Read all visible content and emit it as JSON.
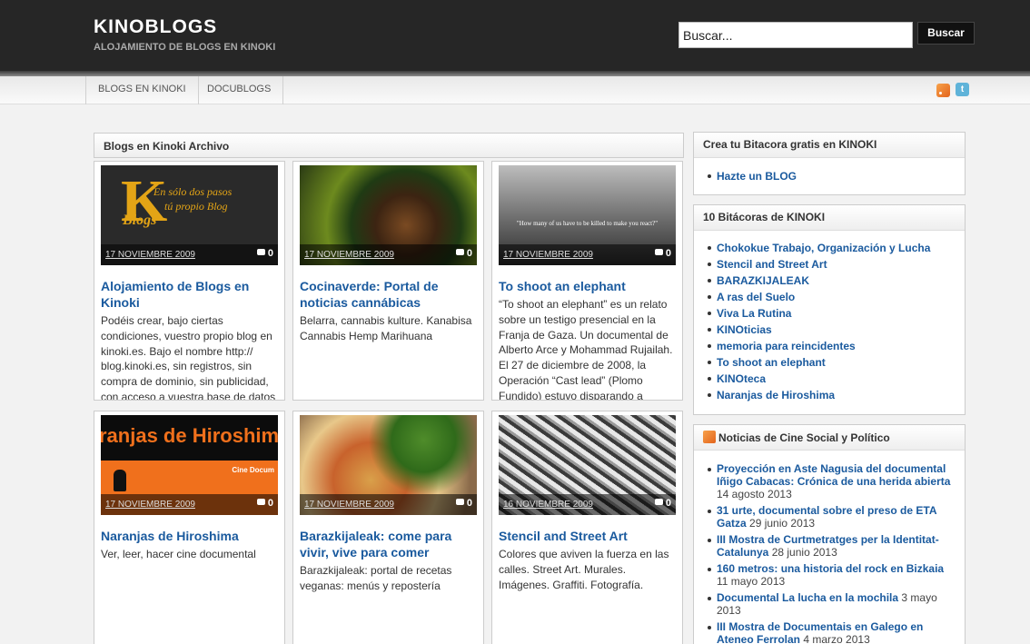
{
  "site": {
    "title": "KINOBLOGS",
    "description": "ALOJAMIENTO DE BLOGS EN KINOKI"
  },
  "search": {
    "value": "Buscar...",
    "button": "Buscar"
  },
  "nav": {
    "items": [
      "BLOGS EN KINOKI",
      "DOCUBLOGS"
    ],
    "icons": [
      "rss-icon",
      "twitter-icon"
    ]
  },
  "main": {
    "heading": "Blogs en Kinoki Archivo",
    "posts": [
      {
        "title": "Alojamiento de Blogs en Kinoki",
        "date": "17 NOVIEMBRE 2009",
        "comments": "0",
        "thumb_text": [
          "K",
          "En sólo dos pasos",
          "tú propio Blog",
          "Blogs"
        ],
        "excerpt": "Podéis crear, bajo ciertas condiciones, vuestro propio blog en kinoki.es. Bajo el nombre http:// blog.kinoki.es, sin registros, sin compra de dominio, sin publicidad, con acceso a vuestra base de datos"
      },
      {
        "title": "Cocinaverde: Portal de noticias cannábicas",
        "date": "17 NOVIEMBRE 2009",
        "comments": "0",
        "excerpt": "Belarra, cannabis kulture. Kanabisa Cannabis Hemp Marihuana"
      },
      {
        "title": "To shoot an elephant",
        "date": "17 NOVIEMBRE 2009",
        "comments": "0",
        "thumb_text": [
          "\"How many of us have to be killed to make you react?\""
        ],
        "excerpt": "“To shoot an elephant” es un relato sobre un testigo presencial en la Franja de Gaza. Un documental de Alberto Arce y Mohammad Rujailah. El 27 de diciembre de 2008, la Operación “Cast lead” (Plomo Fundido) estuvo disparando a"
      },
      {
        "title": "Naranjas de Hiroshima",
        "date": "17 NOVIEMBRE 2009",
        "comments": "0",
        "thumb_text": [
          "ranjas de Hiroshim",
          "Cine Docum"
        ],
        "excerpt": "Ver, leer, hacer cine documental"
      },
      {
        "title": "Barazkijaleak: come para vivir, vive para comer",
        "date": "17 NOVIEMBRE 2009",
        "comments": "0",
        "excerpt": "Barazkijaleak: portal de recetas veganas: menús y repostería"
      },
      {
        "title": "Stencil and Street Art",
        "date": "16 NOVIEMBRE 2009",
        "comments": "0",
        "excerpt": "Colores que aviven la fuerza en las calles. Street Art. Murales. Imágenes. Graffiti. Fotografía."
      }
    ]
  },
  "sidebar": {
    "create": {
      "heading": "Crea tu Bitacora gratis en KINOKI",
      "links": [
        "Hazte un BLOG"
      ]
    },
    "top10": {
      "heading": "10 Bitácoras de KINOKI",
      "links": [
        "Chokokue Trabajo, Organización y Lucha",
        "Stencil and Street Art",
        "BARAZKIJALEAK",
        "A ras del Suelo",
        "Viva La Rutina",
        "KINOticias",
        "memoria para reincidentes",
        "To shoot an elephant",
        "KINOteca",
        "Naranjas de Hiroshima"
      ]
    },
    "news": {
      "heading": "Noticias de Cine Social y Político",
      "items": [
        {
          "title": "Proyección en Aste Nagusia del documental Iñigo Cabacas: Crónica de una herida abierta",
          "date": "14 agosto 2013"
        },
        {
          "title": "31 urte, documental sobre el preso de ETA Gatza",
          "date": "29 junio 2013"
        },
        {
          "title": "III Mostra de Curtmetratges per la Identitat-Catalunya",
          "date": "28 junio 2013"
        },
        {
          "title": "160 metros: una historia del rock en Bizkaia",
          "date": "11 mayo 2013"
        },
        {
          "title": "Documental La lucha en la mochila",
          "date": "3 mayo 2013"
        },
        {
          "title": "III Mostra de Documentais en Galego en Ateneo Ferrolan",
          "date": "4 marzo 2013"
        }
      ]
    }
  },
  "colors": {
    "header_bg": "#262626",
    "link": "#1a5a9e",
    "page_bg": "#f2f2f2"
  }
}
